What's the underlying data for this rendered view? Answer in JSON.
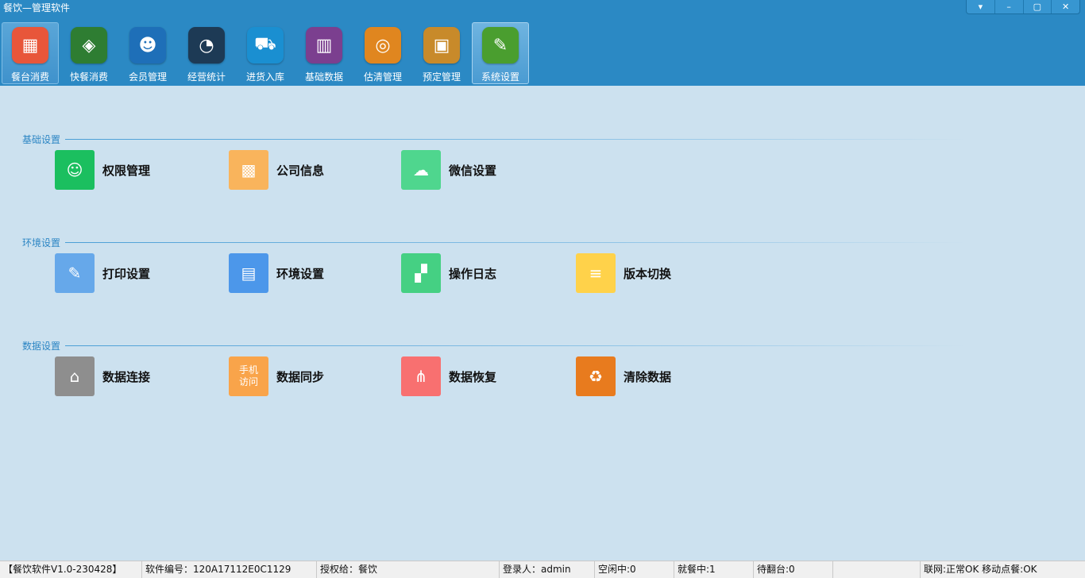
{
  "window": {
    "title": "餐饮—管理软件"
  },
  "window_controls": {
    "menu": "▾",
    "minimize": "–",
    "maximize": "▢",
    "close": "✕"
  },
  "toolbar": [
    {
      "label": "餐台消费",
      "icon": "table-dining-icon",
      "color": "#e8563a",
      "glyph": "▦"
    },
    {
      "label": "快餐消费",
      "icon": "fast-food-icon",
      "color": "#2e7d32",
      "glyph": "◈"
    },
    {
      "label": "会员管理",
      "icon": "member-icon",
      "color": "#1e6fb8",
      "glyph": "☻"
    },
    {
      "label": "经营统计",
      "icon": "dashboard-icon",
      "color": "#1d3a55",
      "glyph": "◔"
    },
    {
      "label": "进货入库",
      "icon": "truck-icon",
      "color": "#1a8fd1",
      "glyph": "⛟"
    },
    {
      "label": "基础数据",
      "icon": "database-books-icon",
      "color": "#7b3f8f",
      "glyph": "▥"
    },
    {
      "label": "估清管理",
      "icon": "refresh-globe-icon",
      "color": "#e0861f",
      "glyph": "◎"
    },
    {
      "label": "预定管理",
      "icon": "reservation-icon",
      "color": "#c88a2a",
      "glyph": "▣"
    },
    {
      "label": "系统设置",
      "icon": "system-settings-icon",
      "color": "#4a9e2f",
      "glyph": "✎"
    }
  ],
  "sections": [
    {
      "title": "基础设置",
      "items": [
        {
          "label": "权限管理",
          "icon": "user-permission-icon",
          "color": "#1bbf5f",
          "glyph": "☺"
        },
        {
          "label": "公司信息",
          "icon": "qrcode-icon",
          "color": "#f9b45c",
          "glyph": "▩"
        },
        {
          "label": "微信设置",
          "icon": "wechat-icon",
          "color": "#4fd68e",
          "glyph": "☁"
        }
      ]
    },
    {
      "title": "环境设置",
      "items": [
        {
          "label": "打印设置",
          "icon": "edit-icon",
          "color": "#66a8ea",
          "glyph": "✎"
        },
        {
          "label": "环境设置",
          "icon": "document-icon",
          "color": "#4c97ea",
          "glyph": "▤"
        },
        {
          "label": "操作日志",
          "icon": "log-grid-icon",
          "color": "#45d083",
          "glyph": "▞"
        },
        {
          "label": "版本切换",
          "icon": "list-icon",
          "color": "#ffd24a",
          "glyph": "≡"
        }
      ]
    },
    {
      "title": "数据设置",
      "items": [
        {
          "label": "数据连接",
          "icon": "upload-home-icon",
          "color": "#8e8e8e",
          "glyph": "⌂"
        },
        {
          "label": "数据同步",
          "icon": "mobile-access-icon",
          "color": "#f9a44a",
          "glyph": "",
          "icon_text": [
            "手机",
            "访问"
          ]
        },
        {
          "label": "数据恢复",
          "icon": "share-icon",
          "color": "#f87070",
          "glyph": "⋔"
        },
        {
          "label": "清除数据",
          "icon": "recycle-icon",
          "color": "#e87b1e",
          "glyph": "♻"
        }
      ]
    }
  ],
  "statusbar": {
    "version": "【餐饮软件V1.0-230428】",
    "serial": "软件编号：120A17112E0C1129",
    "licensed": "授权给：餐饮",
    "login": "登录人：admin",
    "idle": "空闲中:0",
    "dining": "就餐中:1",
    "waiting": "待翻台:0",
    "network": "联网:正常OK 移动点餐:OK"
  }
}
